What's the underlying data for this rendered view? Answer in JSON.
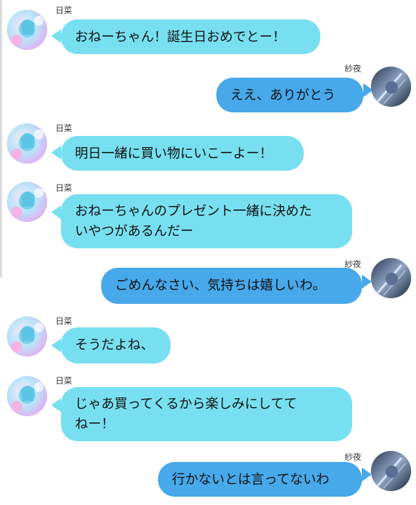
{
  "colors": {
    "incoming_bubble": "#78dff0",
    "outgoing_bubble": "#47a8ea"
  },
  "messages": [
    {
      "sender": "日菜",
      "side": "left",
      "avatar": "hina-avatar",
      "text": "おねーちゃん！誕生日おめでとー！"
    },
    {
      "sender": "紗夜",
      "side": "right",
      "avatar": "sayo-avatar",
      "text": "ええ、ありがとう"
    },
    {
      "sender": "日菜",
      "side": "left",
      "avatar": "hina-avatar",
      "text": "明日一緒に買い物にいこーよー！"
    },
    {
      "sender": "日菜",
      "side": "left",
      "avatar": "hina-avatar",
      "text": "おねーちゃんのプレゼント一緒に決めた\nいやつがあるんだー"
    },
    {
      "sender": "紗夜",
      "side": "right",
      "avatar": "sayo-avatar",
      "text": "ごめんなさい、気持ちは嬉しいわ。"
    },
    {
      "sender": "日菜",
      "side": "left",
      "avatar": "hina-avatar",
      "text": "そうだよね、"
    },
    {
      "sender": "日菜",
      "side": "left",
      "avatar": "hina-avatar",
      "text": "じゃあ買ってくるから楽しみにしてて\nねー！"
    },
    {
      "sender": "紗夜",
      "side": "right",
      "avatar": "sayo-avatar",
      "text": "行かないとは言ってないわ"
    }
  ]
}
